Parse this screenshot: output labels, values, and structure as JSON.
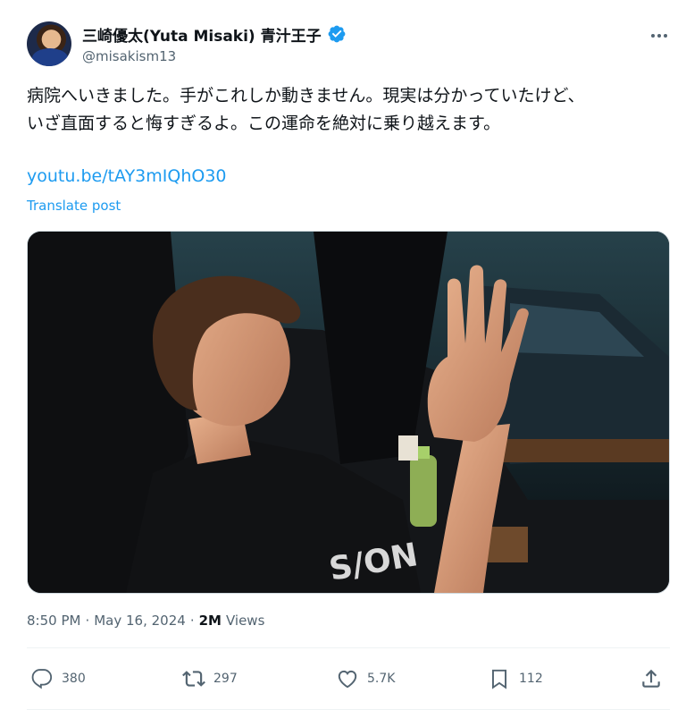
{
  "author": {
    "display_name": "三崎優太(Yuta Misaki) 青汁王子",
    "handle": "@misakism13",
    "verified": true
  },
  "post": {
    "text": "病院へいきました。手がこれしか動きません。現実は分かっていたけど、\nいざ直面すると悔すぎるよ。この運命を絶対に乗り越えます。",
    "link": "youtu.be/tAY3mIQhO30",
    "translate_label": "Translate post"
  },
  "meta": {
    "time": "8:50 PM",
    "separator": "·",
    "date": "May 16, 2024",
    "views_count": "2M",
    "views_label": "Views"
  },
  "actions": {
    "replies": "380",
    "reposts": "297",
    "likes": "5.7K",
    "bookmarks": "112"
  },
  "icons": {
    "verified": "verified-badge-icon",
    "more": "more-icon",
    "reply": "reply-icon",
    "repost": "repost-icon",
    "like": "like-icon",
    "bookmark": "bookmark-icon",
    "share": "share-icon"
  },
  "colors": {
    "link": "#1d9bf0",
    "muted": "#536471",
    "text": "#0f1419"
  }
}
